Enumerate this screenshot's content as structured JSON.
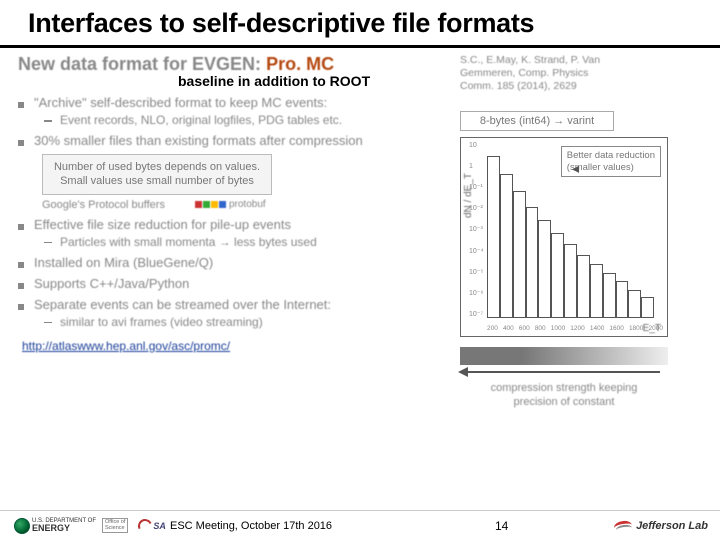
{
  "title": "Interfaces to self-descriptive file formats",
  "subtitle_prefix": "New data format for EVGEN:",
  "subtitle_promc": "Pro. MC",
  "baseline": "baseline in addition to ROOT",
  "bullets": {
    "b1": "\"Archive\" self-described format to keep MC events:",
    "b1s1": "Event records, NLO, original logfiles, PDG tables etc.",
    "b2": "30% smaller files than existing formats after compression",
    "box1_l1": "Number of used bytes depends on values.",
    "box1_l2": "Small values use small number of bytes",
    "proto_label": "Google's Protocol buffers",
    "proto_name": "protobuf",
    "b3": "Effective file size reduction for pile-up events",
    "b3s1": "Particles with small momenta → less bytes used",
    "b4": "Installed on Mira (BlueGene/Q)",
    "b5": "Supports C++/Java/Python",
    "b6": "Separate events can be streamed over the Internet:",
    "b6s1": "similar to avi frames (video streaming)"
  },
  "link": "http://atlaswww.hep.anl.gov/asc/promc/",
  "citation_l1": "S.C., E.May, K. Strand, P. Van",
  "citation_l2": "Gemmeren, Comp. Physics",
  "citation_l3": "Comm. 185 (2014), 2629",
  "varint_box": "8-bytes (int64) → varint",
  "plot": {
    "annot_l1": "Better data reduction",
    "annot_l2": "(smaller values)",
    "ylabel": "dN / dE_T",
    "xlabel": "E_T"
  },
  "caption_l1": "compression strength keeping",
  "caption_l2": "precision of constant",
  "chart_data": {
    "type": "bar",
    "xlabel": "E_T",
    "ylabel": "dN / dE_T",
    "yscale": "log",
    "ylim": [
      1e-07,
      10
    ],
    "xlim": [
      200,
      2000
    ],
    "x_ticks": [
      200,
      400,
      600,
      800,
      1000,
      1200,
      1400,
      1600,
      1800,
      2000
    ],
    "y_ticks": [
      10,
      1,
      0.1,
      0.01,
      0.001,
      0.0001,
      1e-05,
      1e-06,
      1e-07
    ],
    "bin_edges": [
      200,
      330,
      460,
      590,
      720,
      850,
      980,
      1110,
      1240,
      1370,
      1500,
      1630,
      1760,
      1890
    ],
    "values": [
      2.5,
      0.35,
      0.06,
      0.012,
      0.003,
      0.0008,
      0.00025,
      8e-05,
      3e-05,
      1.2e-05,
      5e-06,
      2e-06,
      9e-07
    ],
    "annotation": "Better data reduction (smaller values)"
  },
  "footer": {
    "doe": "U.S. DEPARTMENT OF",
    "energy": "ENERGY",
    "office": "Office of",
    "science": "Science",
    "jsa": "SA",
    "meeting": "ESC Meeting, October 17th 2016",
    "page": "14",
    "jlab": "Jefferson Lab"
  }
}
